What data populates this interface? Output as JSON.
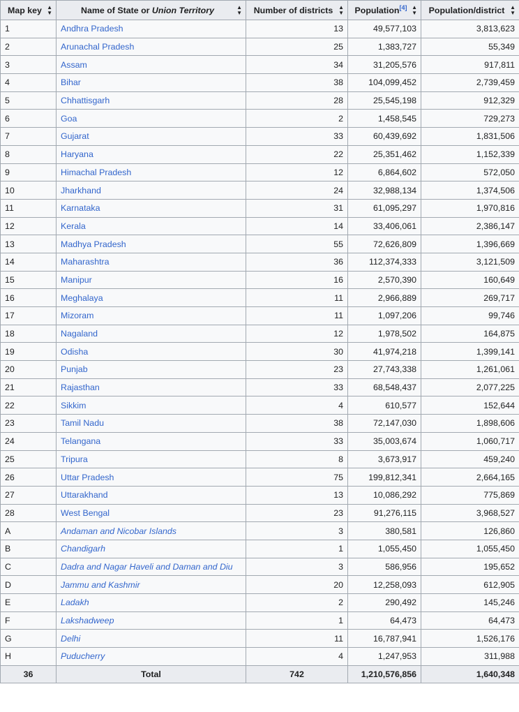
{
  "headers": {
    "map_key": "Map key",
    "name_prefix": "Name of State or ",
    "name_italic": "Union Territory",
    "districts": "Number of districts",
    "population": "Population",
    "population_ref": "[4]",
    "per_district": "Population/district",
    "sort_icon": "sort-icon"
  },
  "rows": [
    {
      "key": "1",
      "name": "Andhra Pradesh",
      "districts": "13",
      "population": "49,577,103",
      "per_district": "3,813,623",
      "ut": false
    },
    {
      "key": "2",
      "name": "Arunachal Pradesh",
      "districts": "25",
      "population": "1,383,727",
      "per_district": "55,349",
      "ut": false
    },
    {
      "key": "3",
      "name": "Assam",
      "districts": "34",
      "population": "31,205,576",
      "per_district": "917,811",
      "ut": false
    },
    {
      "key": "4",
      "name": "Bihar",
      "districts": "38",
      "population": "104,099,452",
      "per_district": "2,739,459",
      "ut": false
    },
    {
      "key": "5",
      "name": "Chhattisgarh",
      "districts": "28",
      "population": "25,545,198",
      "per_district": "912,329",
      "ut": false
    },
    {
      "key": "6",
      "name": "Goa",
      "districts": "2",
      "population": "1,458,545",
      "per_district": "729,273",
      "ut": false
    },
    {
      "key": "7",
      "name": "Gujarat",
      "districts": "33",
      "population": "60,439,692",
      "per_district": "1,831,506",
      "ut": false
    },
    {
      "key": "8",
      "name": "Haryana",
      "districts": "22",
      "population": "25,351,462",
      "per_district": "1,152,339",
      "ut": false
    },
    {
      "key": "9",
      "name": "Himachal Pradesh",
      "districts": "12",
      "population": "6,864,602",
      "per_district": "572,050",
      "ut": false
    },
    {
      "key": "10",
      "name": "Jharkhand",
      "districts": "24",
      "population": "32,988,134",
      "per_district": "1,374,506",
      "ut": false
    },
    {
      "key": "11",
      "name": "Karnataka",
      "districts": "31",
      "population": "61,095,297",
      "per_district": "1,970,816",
      "ut": false
    },
    {
      "key": "12",
      "name": "Kerala",
      "districts": "14",
      "population": "33,406,061",
      "per_district": "2,386,147",
      "ut": false
    },
    {
      "key": "13",
      "name": "Madhya Pradesh",
      "districts": "55",
      "population": "72,626,809",
      "per_district": "1,396,669",
      "ut": false
    },
    {
      "key": "14",
      "name": "Maharashtra",
      "districts": "36",
      "population": "112,374,333",
      "per_district": "3,121,509",
      "ut": false
    },
    {
      "key": "15",
      "name": "Manipur",
      "districts": "16",
      "population": "2,570,390",
      "per_district": "160,649",
      "ut": false
    },
    {
      "key": "16",
      "name": "Meghalaya",
      "districts": "11",
      "population": "2,966,889",
      "per_district": "269,717",
      "ut": false
    },
    {
      "key": "17",
      "name": "Mizoram",
      "districts": "11",
      "population": "1,097,206",
      "per_district": "99,746",
      "ut": false
    },
    {
      "key": "18",
      "name": "Nagaland",
      "districts": "12",
      "population": "1,978,502",
      "per_district": "164,875",
      "ut": false
    },
    {
      "key": "19",
      "name": "Odisha",
      "districts": "30",
      "population": "41,974,218",
      "per_district": "1,399,141",
      "ut": false
    },
    {
      "key": "20",
      "name": "Punjab",
      "districts": "23",
      "population": "27,743,338",
      "per_district": "1,261,061",
      "ut": false
    },
    {
      "key": "21",
      "name": "Rajasthan",
      "districts": "33",
      "population": "68,548,437",
      "per_district": "2,077,225",
      "ut": false
    },
    {
      "key": "22",
      "name": "Sikkim",
      "districts": "4",
      "population": "610,577",
      "per_district": "152,644",
      "ut": false
    },
    {
      "key": "23",
      "name": "Tamil Nadu",
      "districts": "38",
      "population": "72,147,030",
      "per_district": "1,898,606",
      "ut": false
    },
    {
      "key": "24",
      "name": "Telangana",
      "districts": "33",
      "population": "35,003,674",
      "per_district": "1,060,717",
      "ut": false
    },
    {
      "key": "25",
      "name": "Tripura",
      "districts": "8",
      "population": "3,673,917",
      "per_district": "459,240",
      "ut": false
    },
    {
      "key": "26",
      "name": "Uttar Pradesh",
      "districts": "75",
      "population": "199,812,341",
      "per_district": "2,664,165",
      "ut": false
    },
    {
      "key": "27",
      "name": "Uttarakhand",
      "districts": "13",
      "population": "10,086,292",
      "per_district": "775,869",
      "ut": false
    },
    {
      "key": "28",
      "name": "West Bengal",
      "districts": "23",
      "population": "91,276,115",
      "per_district": "3,968,527",
      "ut": false
    },
    {
      "key": "A",
      "name": "Andaman and Nicobar Islands",
      "districts": "3",
      "population": "380,581",
      "per_district": "126,860",
      "ut": true
    },
    {
      "key": "B",
      "name": "Chandigarh",
      "districts": "1",
      "population": "1,055,450",
      "per_district": "1,055,450",
      "ut": true
    },
    {
      "key": "C",
      "name": "Dadra and Nagar Haveli and Daman and Diu",
      "districts": "3",
      "population": "586,956",
      "per_district": "195,652",
      "ut": true
    },
    {
      "key": "D",
      "name": "Jammu and Kashmir",
      "districts": "20",
      "population": "12,258,093",
      "per_district": "612,905",
      "ut": true
    },
    {
      "key": "E",
      "name": "Ladakh",
      "districts": "2",
      "population": "290,492",
      "per_district": "145,246",
      "ut": true
    },
    {
      "key": "F",
      "name": "Lakshadweep",
      "districts": "1",
      "population": "64,473",
      "per_district": "64,473",
      "ut": true
    },
    {
      "key": "G",
      "name": "Delhi",
      "districts": "11",
      "population": "16,787,941",
      "per_district": "1,526,176",
      "ut": true
    },
    {
      "key": "H",
      "name": "Puducherry",
      "districts": "4",
      "population": "1,247,953",
      "per_district": "311,988",
      "ut": true
    }
  ],
  "total": {
    "key": "36",
    "label": "Total",
    "districts": "742",
    "population": "1,210,576,856",
    "per_district": "1,640,348"
  },
  "colors": {
    "link": "#3366cc",
    "header_bg": "#eaecf0",
    "cell_bg": "#f8f9fa",
    "border": "#a2a9b1"
  }
}
